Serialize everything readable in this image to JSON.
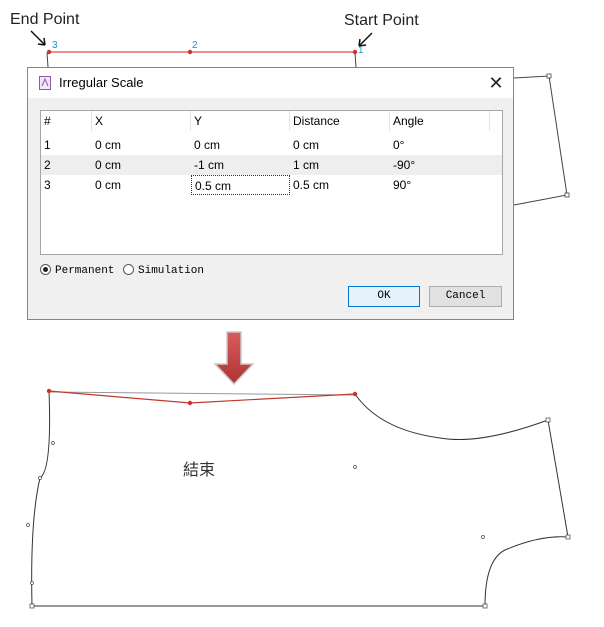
{
  "annotations": {
    "end_point": "End Point",
    "start_point": "Start Point",
    "point_labels": [
      "3",
      "2",
      "1"
    ],
    "result_text": "結束"
  },
  "dialog": {
    "title": "Irregular Scale",
    "columns": [
      "#",
      "X",
      "Y",
      "Distance",
      "Angle"
    ],
    "rows": [
      [
        "1",
        "0 cm",
        "0 cm",
        "0 cm",
        "0°"
      ],
      [
        "2",
        "0 cm",
        "-1 cm",
        "1 cm",
        "-90°"
      ],
      [
        "3",
        "0 cm",
        "0.5 cm",
        "0.5 cm",
        "90°"
      ]
    ],
    "options": {
      "permanent": "Permanent",
      "simulation": "Simulation",
      "selected": "Permanent"
    },
    "ok_label": "OK",
    "cancel_label": "Cancel"
  },
  "colors": {
    "pattern_line": "#222222",
    "modified_line": "#c0392b",
    "point_label": "#1f8fc7",
    "arrow": "#c0392b",
    "dialog_border": "#58a650"
  }
}
